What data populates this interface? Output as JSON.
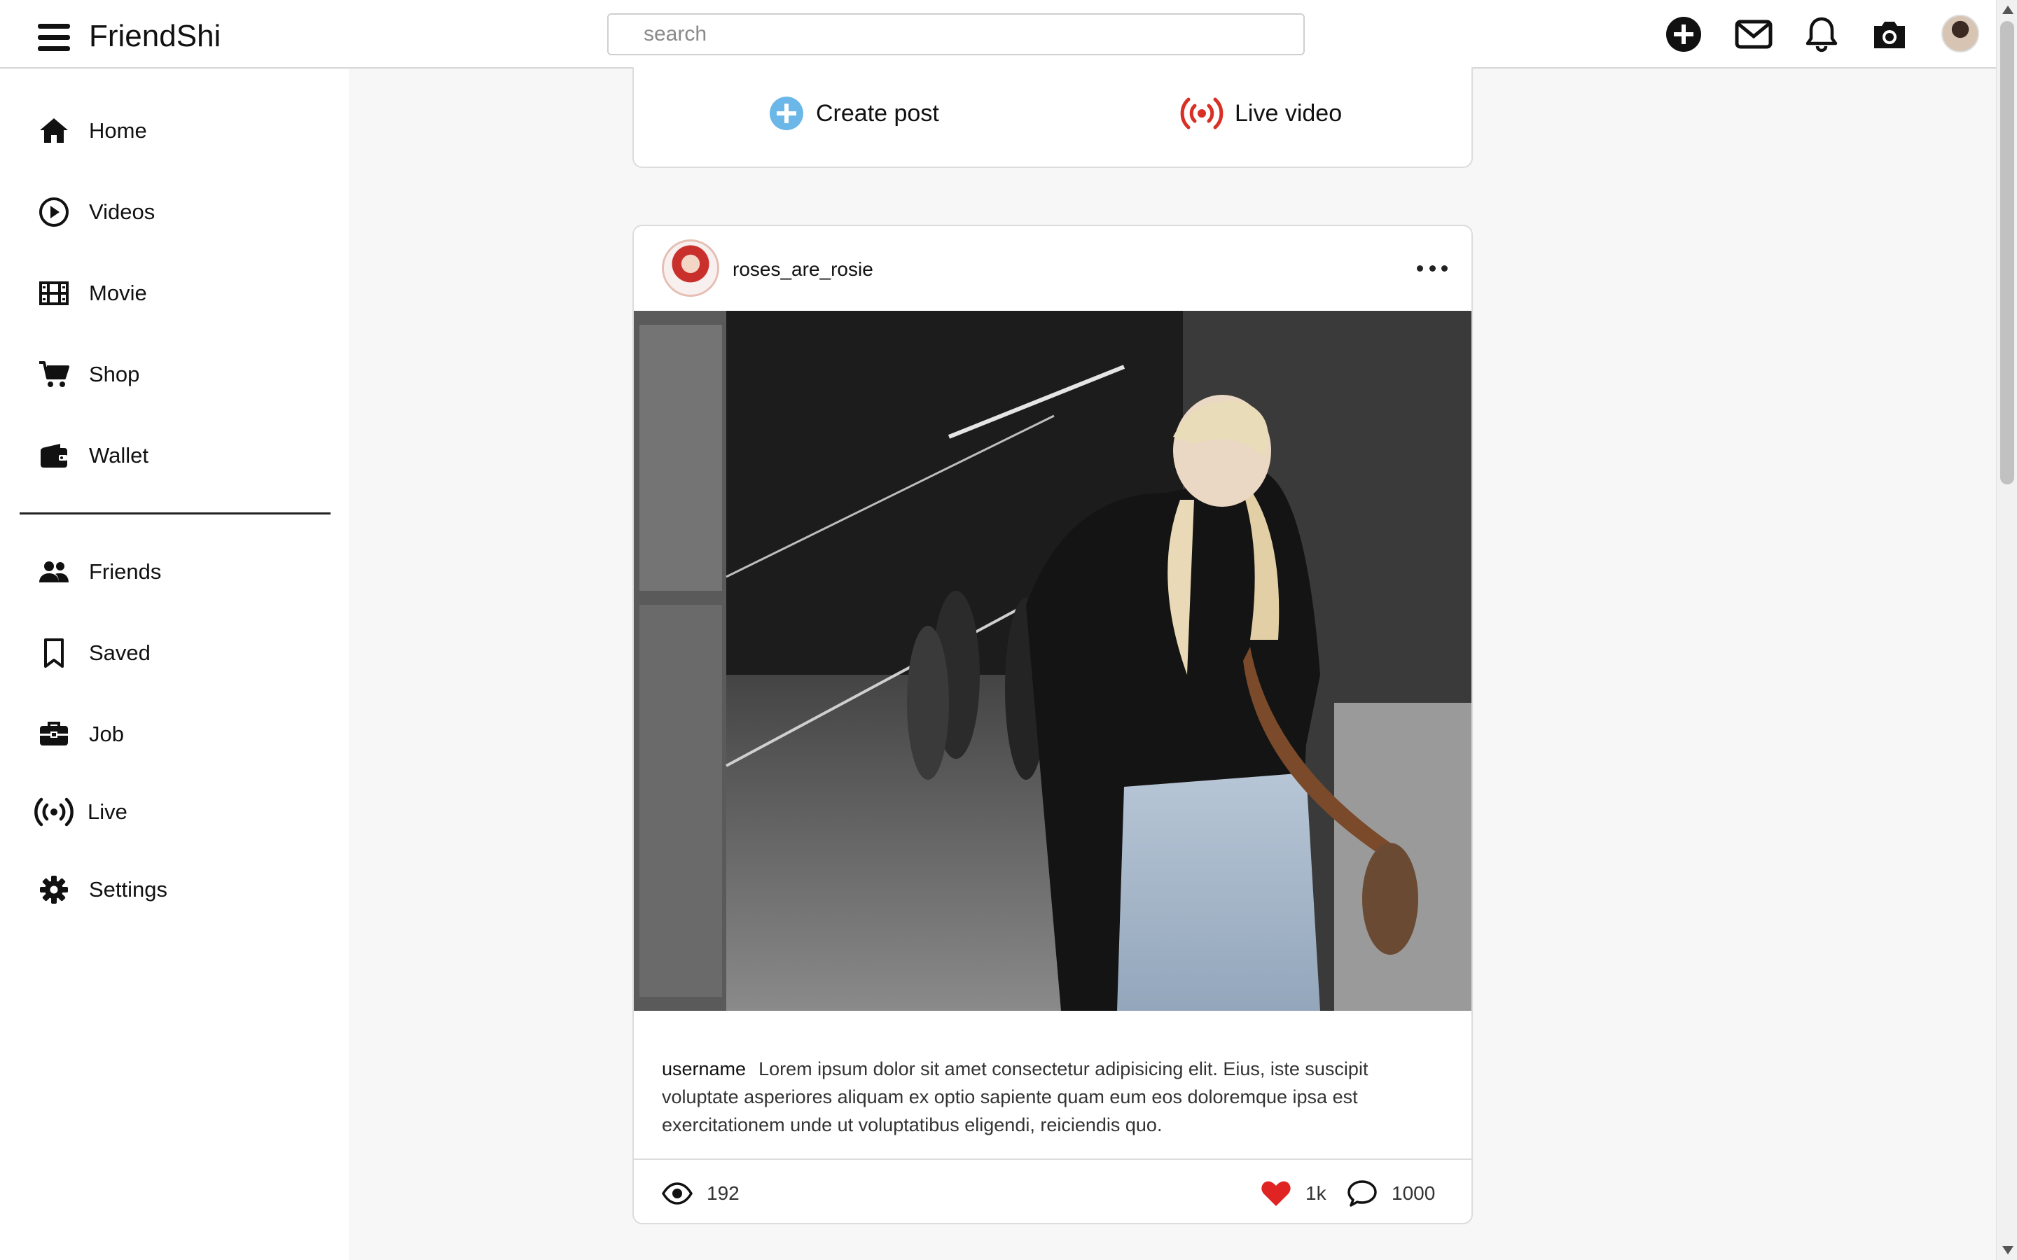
{
  "app": {
    "title": "FriendShi"
  },
  "search": {
    "placeholder": "search"
  },
  "topbar_icons": [
    "plus-circle-icon",
    "envelope-icon",
    "bell-icon",
    "camera-icon",
    "profile-avatar"
  ],
  "sidebar": {
    "items": [
      {
        "label": "Home",
        "icon": "home-icon"
      },
      {
        "label": "Videos",
        "icon": "play-circle-icon"
      },
      {
        "label": "Movie",
        "icon": "film-icon"
      },
      {
        "label": "Shop",
        "icon": "cart-icon"
      },
      {
        "label": "Wallet",
        "icon": "wallet-icon"
      }
    ],
    "items2": [
      {
        "label": "Friends",
        "icon": "users-icon"
      },
      {
        "label": "Saved",
        "icon": "bookmark-icon"
      },
      {
        "label": "Job",
        "icon": "briefcase-icon"
      },
      {
        "label": "Live",
        "icon": "broadcast-icon"
      },
      {
        "label": "Settings",
        "icon": "gear-icon"
      }
    ]
  },
  "create": {
    "create_post_label": "Create post",
    "live_video_label": "Live video"
  },
  "post": {
    "username": "roses_are_rosie",
    "caption_user": "username",
    "caption_text": "Lorem ipsum dolor sit amet consectetur adipisicing elit. Eius, iste suscipit voluptate asperiores aliquam ex optio sapiente quam eum eos doloremque ipsa est exercitationem unde ut voluptatibus eligendi, reiciendis quo.",
    "views": "192",
    "likes": "1k",
    "comments": "1000"
  },
  "colors": {
    "accent_blue": "#6ab7e8",
    "live_red": "#d93025",
    "heart_red": "#e02424"
  }
}
